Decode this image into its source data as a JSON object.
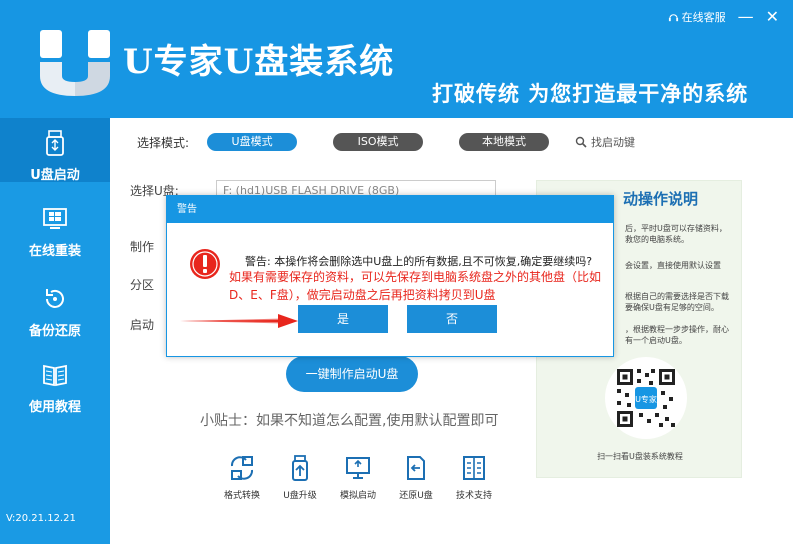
{
  "app": {
    "title": "U专家U盘装系统",
    "slogan": "打破传统  为您打造最干净的系统",
    "service_label": "在线客服",
    "minimize": "—",
    "close": "✕"
  },
  "sidebar": {
    "items": [
      {
        "label": "U盘启动",
        "icon": "usb-icon"
      },
      {
        "label": "在线重装",
        "icon": "windows-icon"
      },
      {
        "label": "备份还原",
        "icon": "restore-icon"
      },
      {
        "label": "使用教程",
        "icon": "book-icon"
      }
    ],
    "version": "V:20.21.12.21"
  },
  "main": {
    "mode_label": "选择模式:",
    "modes": [
      "U盘模式",
      "ISO模式",
      "本地模式"
    ],
    "find_key": "找启动键",
    "fields": {
      "select_usb": "选择U盘:",
      "make": "制作",
      "partition": "分区",
      "boot": "启动"
    },
    "usb_value": "F: (hd1)USB FLASH DRIVE (8GB)",
    "make_button": "一键制作启动U盘",
    "tip": "小贴士：如果不知道怎么配置,使用默认配置即可",
    "tools": [
      "格式转换",
      "U盘升级",
      "模拟启动",
      "还原U盘",
      "技术支持"
    ]
  },
  "help_panel": {
    "title": "动操作说明",
    "lines": [
      "后，平时U盘可以存储资料，",
      "救您的电脑系统。",
      "会设置，直接使用默认设置",
      "根据自己的需要选择是否下载",
      "要确保U盘有足够的空间。",
      "，根据教程一步步操作，耐心",
      "有一个启动U盘。"
    ],
    "qr_caption": "扫一扫看U盘装系统教程",
    "qr_text": "U专家"
  },
  "dialog": {
    "title": "警告",
    "message": "警告: 本操作将会删除选中U盘上的所有数据,且不可恢复,确定要继续吗?",
    "note": "如果有需要保存的资料，可以先保存到电脑系统盘之外的其他盘（比如D、E、F盘），做完启动盘之后再把资料拷贝到U盘",
    "yes": "是",
    "no": "否"
  },
  "colors": {
    "primary": "#1796e3",
    "button": "#1c8ed8",
    "warning_red": "#e8261d"
  }
}
